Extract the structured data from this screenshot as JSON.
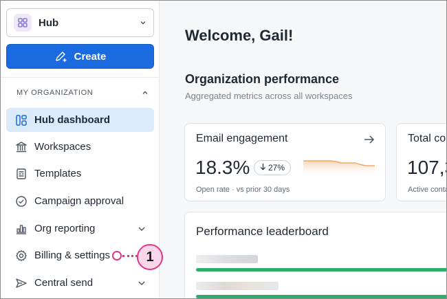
{
  "sidebar": {
    "hub_label": "Hub",
    "create_label": "Create",
    "section_title": "MY ORGANIZATION",
    "items": [
      {
        "label": "Hub dashboard",
        "icon": "dashboard-icon",
        "active": true
      },
      {
        "label": "Workspaces",
        "icon": "building-icon"
      },
      {
        "label": "Templates",
        "icon": "templates-icon"
      },
      {
        "label": "Campaign approval",
        "icon": "check-circle-icon"
      },
      {
        "label": "Org reporting",
        "icon": "chart-icon",
        "expandable": true
      },
      {
        "label": "Billing & settings",
        "icon": "gear-icon"
      },
      {
        "label": "Central send",
        "icon": "send-icon",
        "expandable": true
      }
    ]
  },
  "callout": {
    "number": "1"
  },
  "main": {
    "welcome": "Welcome, Gail!",
    "performance_title": "Organization performance",
    "performance_subtitle": "Aggregated metrics across all workspaces",
    "email_card": {
      "title": "Email engagement",
      "value": "18.3%",
      "delta": "27%",
      "footer": "Open rate · vs prior 30 days"
    },
    "total_card": {
      "title": "Total co",
      "value": "107,3",
      "footer": "Active conta"
    },
    "leaderboard": {
      "title": "Performance leaderboard"
    }
  },
  "colors": {
    "accent": "#1a6ae0",
    "active_bg": "#dcebfb",
    "callout": "#e0368a",
    "bar": "#2fae6a",
    "sparkline": "#f0a868"
  }
}
